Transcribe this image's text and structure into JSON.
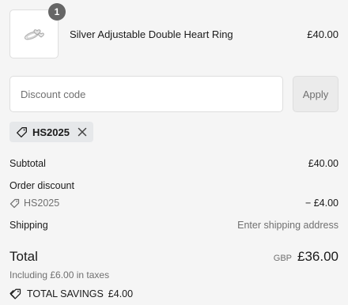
{
  "cart": {
    "quantity": "1",
    "item_name": "Silver Adjustable Double Heart Ring",
    "item_price": "£40.00"
  },
  "discount": {
    "placeholder": "Discount code",
    "apply_label": "Apply",
    "applied_code": "HS2025"
  },
  "summary": {
    "subtotal_label": "Subtotal",
    "subtotal_value": "£40.00",
    "order_discount_label": "Order discount",
    "discount_code": "HS2025",
    "discount_value": "− £4.00",
    "shipping_label": "Shipping",
    "shipping_value": "Enter shipping address",
    "total_label": "Total",
    "currency": "GBP",
    "total_value": "£36.00",
    "tax_note": "Including £6.00 in taxes",
    "savings_label": "TOTAL SAVINGS",
    "savings_value": "£4.00"
  },
  "icons": {
    "tag": "tag-icon",
    "close": "close-icon",
    "savings": "price-tags-icon"
  },
  "colors": {
    "background": "#f5f5f5",
    "badge": "#666666",
    "chip": "#e6e8ea",
    "muted_text": "#707070"
  }
}
